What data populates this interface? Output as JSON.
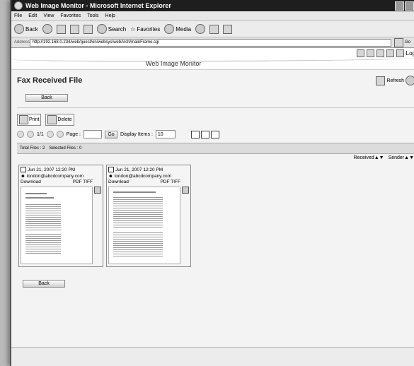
{
  "window": {
    "title": "Web Image Monitor - Microsoft Internet Explorer"
  },
  "menu": [
    "File",
    "Edit",
    "View",
    "Favorites",
    "Tools",
    "Help"
  ],
  "toolbar": {
    "back_label": "Back",
    "search_label": "Search",
    "favorites_label": "Favorites",
    "media_label": "Media"
  },
  "address": {
    "label": "Address",
    "url": "http://192.168.0.234/web/guest/en/websys/webArch/mainFrame.cgi",
    "links_label": "Go"
  },
  "app": {
    "title": "Web Image Monitor",
    "logout_label": "Log"
  },
  "page": {
    "title": "Fax Received File",
    "refresh_label": "Refresh",
    "back_label": "Back",
    "print_label": "Print",
    "delete_label": "Delete",
    "page_info": "1/1",
    "page_label": "Page :",
    "go_label": "Go",
    "display_items_label": "Display Items :",
    "display_items_value": "10",
    "total_files": "Total Files : 2",
    "selected_files": "Selected Files : 0",
    "sort_received": "Received▲▼",
    "sort_sender": "Sender▲▼",
    "back_bottom_label": "Back"
  },
  "files": [
    {
      "date": "Jun 21, 2007 12:20 PM",
      "sender": "london@abcdcompany.com",
      "download": "Download",
      "type": "PDF TIFF"
    },
    {
      "date": "Jun 21, 2007 12:20 PM",
      "sender": "london@abcdcompany.com",
      "download": "Download",
      "type": "PDF TIFF"
    }
  ]
}
